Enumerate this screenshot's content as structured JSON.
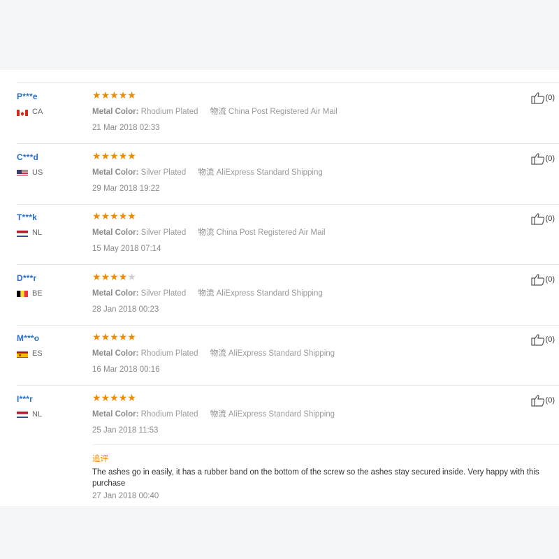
{
  "reviews": [
    {
      "user": "P***e",
      "country": "CA",
      "flag": "ca",
      "rating": 5,
      "metal_label": "Metal Color:",
      "metal_value": "Rhodium Plated",
      "ship_label": "物流",
      "ship_value": "China Post Registered Air Mail",
      "date": "21 Mar 2018 02:33",
      "helpful_count": "(0)"
    },
    {
      "user": "C***d",
      "country": "US",
      "flag": "us",
      "rating": 5,
      "metal_label": "Metal Color:",
      "metal_value": "Silver Plated",
      "ship_label": "物流",
      "ship_value": "AliExpress Standard Shipping",
      "date": "29 Mar 2018 19:22",
      "helpful_count": "(0)"
    },
    {
      "user": "T***k",
      "country": "NL",
      "flag": "nl",
      "rating": 5,
      "metal_label": "Metal Color:",
      "metal_value": "Silver Plated",
      "ship_label": "物流",
      "ship_value": "China Post Registered Air Mail",
      "date": "15 May 2018 07:14",
      "helpful_count": "(0)"
    },
    {
      "user": "D***r",
      "country": "BE",
      "flag": "be",
      "rating": 4,
      "metal_label": "Metal Color:",
      "metal_value": "Silver Plated",
      "ship_label": "物流",
      "ship_value": "AliExpress Standard Shipping",
      "date": "28 Jan 2018 00:23",
      "helpful_count": "(0)"
    },
    {
      "user": "M***o",
      "country": "ES",
      "flag": "es",
      "rating": 5,
      "metal_label": "Metal Color:",
      "metal_value": "Rhodium Plated",
      "ship_label": "物流",
      "ship_value": "AliExpress Standard Shipping",
      "date": "16 Mar 2018 00:16",
      "helpful_count": "(0)"
    },
    {
      "user": "I***r",
      "country": "NL",
      "flag": "nl",
      "rating": 5,
      "metal_label": "Metal Color:",
      "metal_value": "Rhodium Plated",
      "ship_label": "物流",
      "ship_value": "AliExpress Standard Shipping",
      "date": "25 Jan 2018 11:53",
      "helpful_count": "(0)",
      "followup": {
        "title": "追评",
        "text": "The ashes go in easily, it has a rubber band on the bottom of the screw so the ashes stay secured inside. Very happy with this purchase",
        "date": "27 Jan 2018 00:40"
      }
    }
  ],
  "colors": {
    "star_on": "#f08a00",
    "star_off": "#cfcfcf",
    "user_name": "#2a6fc9",
    "followup_title": "#f08a00"
  },
  "icons": {
    "star": "star-icon",
    "helpful": "thumbs-up-icon",
    "flag": "flag-icon"
  }
}
